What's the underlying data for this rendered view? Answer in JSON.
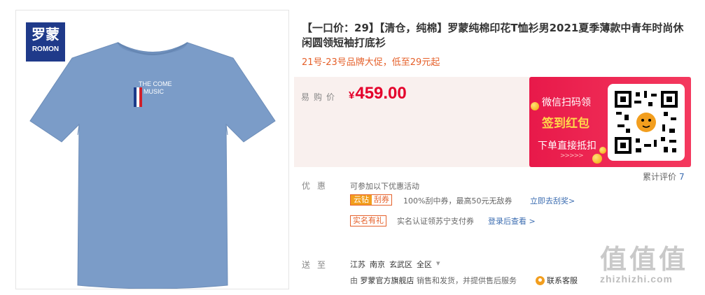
{
  "product": {
    "brand_logo": {
      "cn": "罗蒙",
      "en": "ROMON"
    },
    "shirt_print": {
      "line1": "THE COME",
      "line2": "MUSIC"
    },
    "title": "【一口价：29】【清仓，纯棉】罗蒙纯棉印花T恤衫男2021夏季薄款中青年时尚休闲圆领短袖打底衫",
    "promo_text": "21号-23号品牌大促，低至29元起",
    "shirt_color": "#7b9cc8"
  },
  "price": {
    "label": "易购价",
    "currency": "¥",
    "value": "459.00"
  },
  "ad": {
    "line1": "微信扫码领",
    "line2": "签到红包",
    "line3": "下单直接抵扣",
    "arrows": ">>>>>"
  },
  "review": {
    "label": "累计评价",
    "count": "7"
  },
  "promotions": {
    "label": "优惠",
    "intro": "可参加以下优惠活动",
    "items": [
      {
        "tag_a": "云钻",
        "tag_b": "刮券",
        "desc": "100%刮中券，最高50元无敌券",
        "link": "立即去刮奖>"
      },
      {
        "tag": "实名有礼",
        "desc": "实名认证领苏宁支付券",
        "link": "登录后查看 >"
      }
    ]
  },
  "delivery": {
    "label": "送至",
    "province": "江苏",
    "city": "南京",
    "district": "玄武区",
    "area": "全区",
    "caret": "▾"
  },
  "seller": {
    "prefix": "由",
    "store": "罗蒙官方旗舰店",
    "suffix": "销售和发货，并提供售后服务",
    "service": "联系客服"
  },
  "watermark": {
    "chars": "值值值",
    "url": "zhizhizhi.com"
  },
  "colors": {
    "accent_red": "#e4002b",
    "orange": "#e5602a",
    "link_blue": "#3c6db1",
    "ad_red": "#e8194a",
    "logo_blue": "#1f3a8a"
  }
}
